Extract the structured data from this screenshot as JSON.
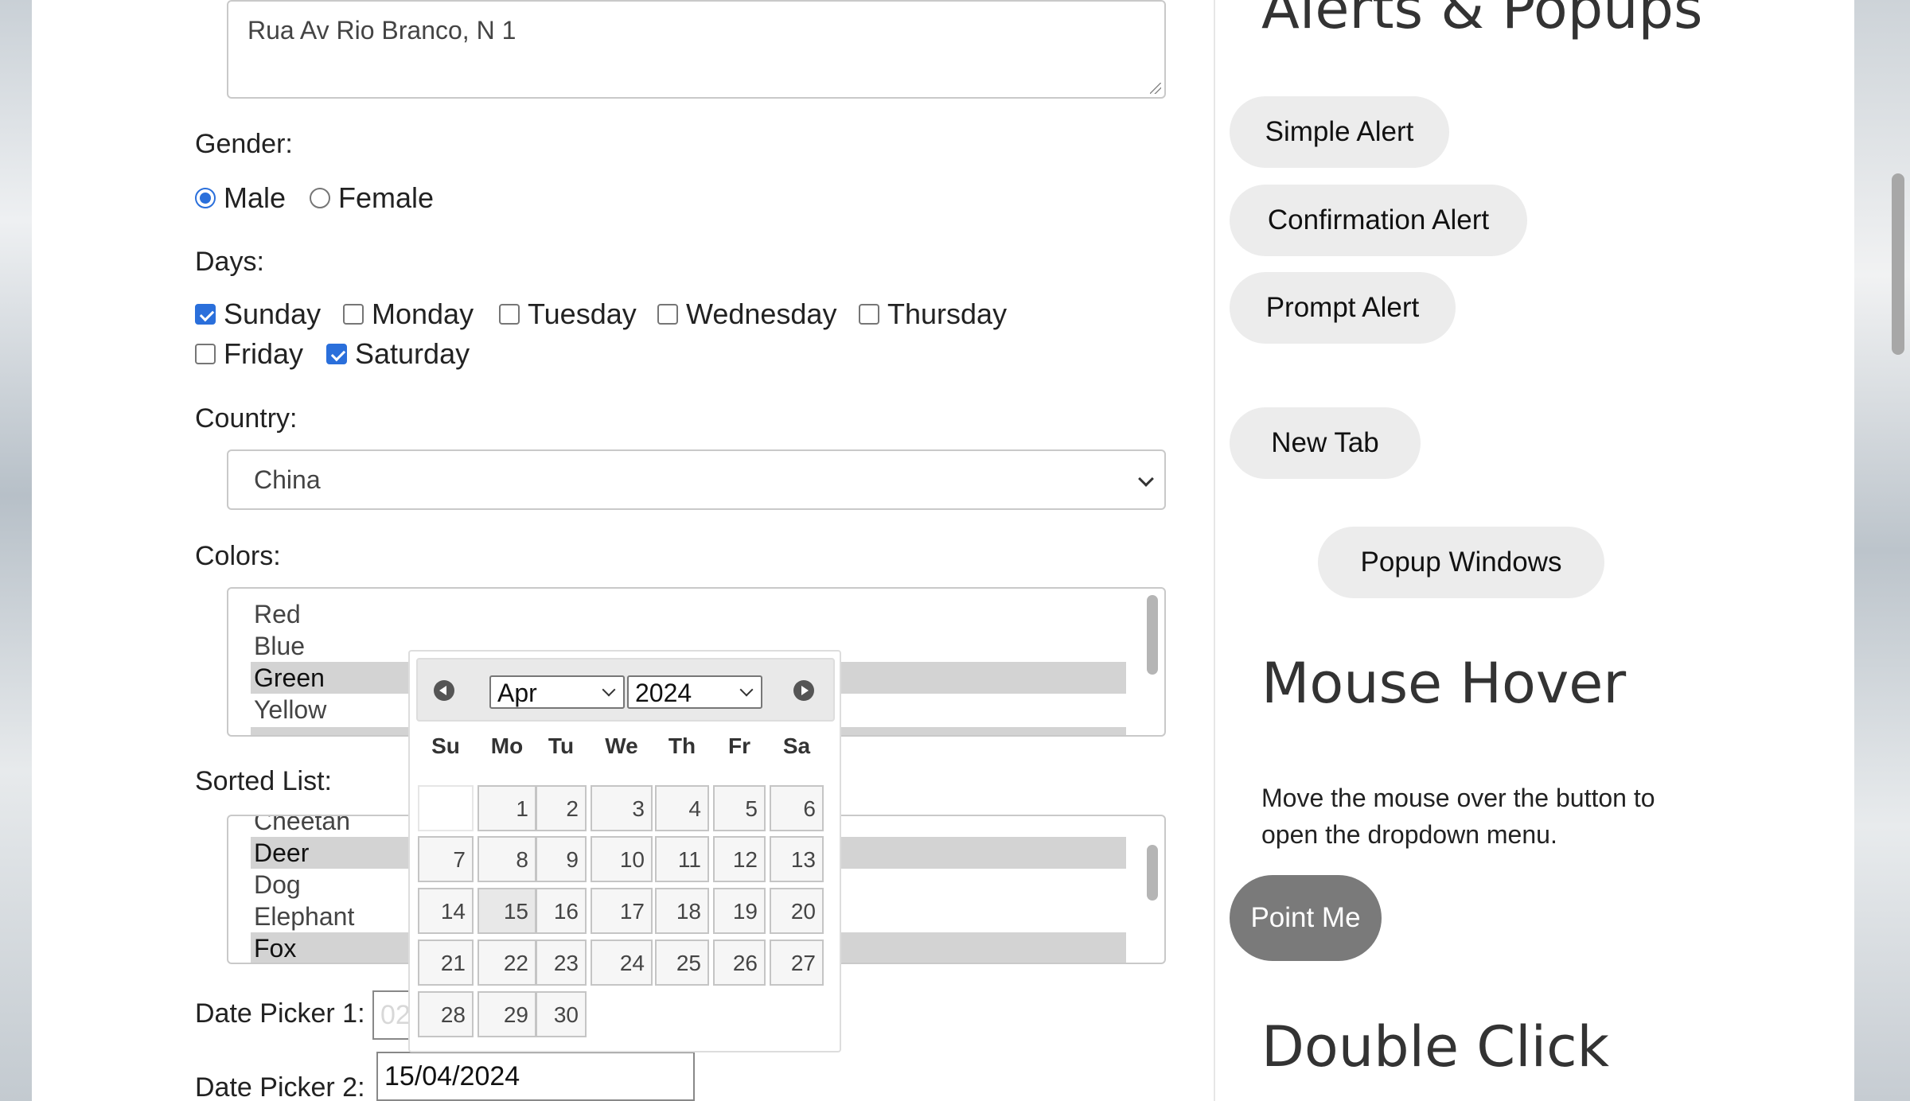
{
  "form": {
    "address_value": "Rua Av Rio Branco, N 1",
    "gender_label": "Gender:",
    "gender_options": [
      "Male",
      "Female"
    ],
    "days_label": "Days:",
    "days": [
      "Sunday",
      "Monday",
      "Tuesday",
      "Wednesday",
      "Thursday",
      "Friday",
      "Saturday"
    ],
    "country_label": "Country:",
    "country_value": "China",
    "colors_label": "Colors:",
    "colors": [
      "Red",
      "Blue",
      "Green",
      "Yellow"
    ],
    "sorted_label": "Sorted List:",
    "sorted_items": [
      "Cheetah",
      "Deer",
      "Dog",
      "Elephant",
      "Fox"
    ],
    "date1_label": "Date Picker 1:",
    "date1_value": "02/2/2025",
    "date2_label": "Date Picker 2:",
    "date2_value": "15/04/2024"
  },
  "datepicker": {
    "month": "Apr",
    "year": "2024",
    "weekdays": [
      "Su",
      "Mo",
      "Tu",
      "We",
      "Th",
      "Fr",
      "Sa"
    ],
    "days": [
      "1",
      "2",
      "3",
      "4",
      "5",
      "6",
      "7",
      "8",
      "9",
      "10",
      "11",
      "12",
      "13",
      "14",
      "15",
      "16",
      "17",
      "18",
      "19",
      "20",
      "21",
      "22",
      "23",
      "24",
      "25",
      "26",
      "27",
      "28",
      "29",
      "30"
    ]
  },
  "alerts": {
    "title": "Alerts & Popups",
    "simple": "Simple Alert",
    "confirm": "Confirmation Alert",
    "prompt": "Prompt Alert",
    "new_tab": "New Tab",
    "popup": "Popup Windows"
  },
  "hover": {
    "title": "Mouse Hover",
    "text": "Move the mouse over the button to open the dropdown menu.",
    "button": "Point Me"
  },
  "double_click": {
    "title": "Double Click"
  }
}
